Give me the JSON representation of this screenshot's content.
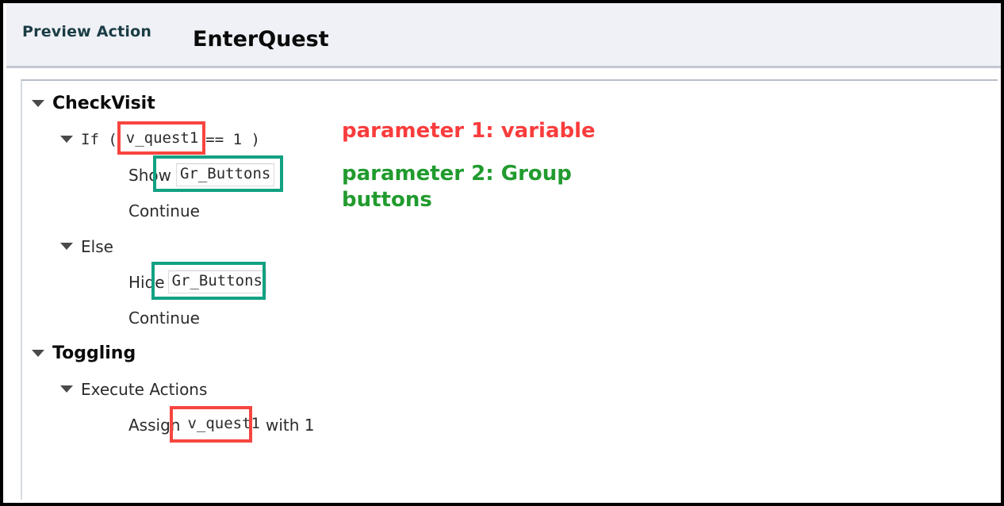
{
  "header": {
    "preview_label": "Preview Action",
    "action_title": "EnterQuest"
  },
  "tree": {
    "nodes": [
      {
        "label": "CheckVisit",
        "level": 0,
        "caret": true,
        "style": "bold"
      },
      {
        "label": "If (",
        "level": 1,
        "caret": true,
        "style": "mono",
        "param": "v_quest1",
        "suffix": "== 1  )",
        "highlight": "red"
      },
      {
        "label": "Show",
        "level": 2,
        "caret": false,
        "style": "plain",
        "param": "Gr_Buttons",
        "suffix": "",
        "highlight": "green"
      },
      {
        "label": "Continue",
        "level": 2,
        "caret": false,
        "style": "plain"
      },
      {
        "label": "Else",
        "level": 1,
        "caret": true,
        "style": "plain"
      },
      {
        "label": "Hide",
        "level": 2,
        "caret": false,
        "style": "plain",
        "param": "Gr_Buttons",
        "suffix": "",
        "highlight": "green"
      },
      {
        "label": "Continue",
        "level": 2,
        "caret": false,
        "style": "plain"
      },
      {
        "label": "Toggling",
        "level": 0,
        "caret": true,
        "style": "bold"
      },
      {
        "label": "Execute Actions",
        "level": 1,
        "caret": true,
        "style": "plain"
      },
      {
        "label": "Assign",
        "level": 2,
        "caret": false,
        "style": "plain",
        "param": "v_quest1",
        "suffix": "with 1",
        "highlight": "red"
      }
    ]
  },
  "annotations": {
    "parameter1": "parameter 1: variable",
    "parameter2": "parameter 2: Group\nbuttons"
  },
  "colors": {
    "highlight_red": "#f7453f",
    "highlight_green": "#12a183",
    "callout_red": "#fa3c3c",
    "callout_green": "#219b2e",
    "header_bg": "#eff1f6",
    "preview_label_color": "#1b3c45"
  }
}
